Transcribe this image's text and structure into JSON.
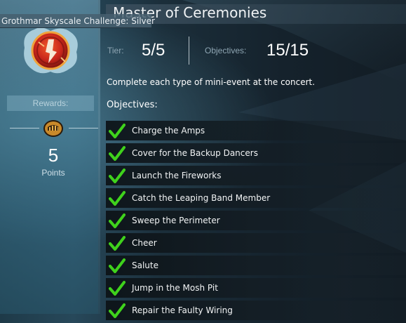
{
  "header": {
    "challenge_tag": "Grothmar Skyscale Challenge: Silver",
    "title": "Master of Ceremonies"
  },
  "rewards": {
    "label": "Rewards:",
    "points_value": "5",
    "points_label": "Points"
  },
  "progress": {
    "tier_label": "Tier:",
    "tier_value": "5/5",
    "objectives_label": "Objectives:",
    "objectives_value": "15/15"
  },
  "description": "Complete each type of mini-event at the concert.",
  "objectives_heading": "Objectives:",
  "objectives": [
    {
      "label": "Charge the Amps",
      "completed": true
    },
    {
      "label": "Cover for the Backup Dancers",
      "completed": true
    },
    {
      "label": "Launch the Fireworks",
      "completed": true
    },
    {
      "label": "Catch the Leaping Band Member",
      "completed": true
    },
    {
      "label": "Sweep the Perimeter",
      "completed": true
    },
    {
      "label": "Cheer",
      "completed": true
    },
    {
      "label": "Salute",
      "completed": true
    },
    {
      "label": "Jump in the Mosh Pit",
      "completed": true
    },
    {
      "label": "Repair the Faulty Wiring",
      "completed": true
    }
  ],
  "colors": {
    "check": "#3fd21c",
    "emblem_red": "#c8261b",
    "coin": "#c9892a"
  },
  "icons": {
    "emblem": "achievement-emblem-icon",
    "coin": "achievement-point-icon",
    "check": "checkmark-icon"
  }
}
